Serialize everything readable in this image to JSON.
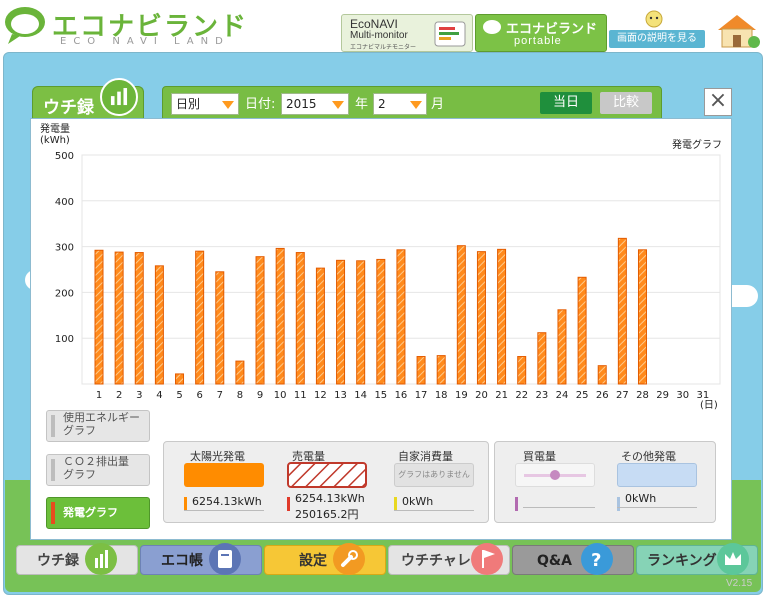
{
  "header": {
    "logo_text": "エコナビランド",
    "logo_sub": "ECO NAVI LAND",
    "econavi": {
      "line1": "EcoNAVI",
      "line2": "Multi-monitor",
      "line3": "エコナビマルチモニター"
    },
    "portable": {
      "line1": "エコナビランド",
      "line2": "portable"
    },
    "help_label": "画面の説明を見る"
  },
  "tab": {
    "label": "ウチ録"
  },
  "controls": {
    "period_value": "日別",
    "date_label": "日付:",
    "year_value": "2015",
    "year_suffix": "年",
    "month_value": "2",
    "month_suffix": "月",
    "today_label": "当日",
    "compare_label": "比較",
    "close_label": "×"
  },
  "chart_data": {
    "type": "bar",
    "title": "発電グラフ",
    "ylabel": "発電量\n(kWh)",
    "xlabel": "(日)",
    "ylim": [
      0,
      500
    ],
    "yticks": [
      100,
      200,
      300,
      400,
      500
    ],
    "grid": true,
    "categories": [
      "1",
      "2",
      "3",
      "4",
      "5",
      "6",
      "7",
      "8",
      "9",
      "10",
      "11",
      "12",
      "13",
      "14",
      "15",
      "16",
      "17",
      "18",
      "19",
      "20",
      "21",
      "22",
      "23",
      "24",
      "25",
      "26",
      "27",
      "28",
      "29",
      "30",
      "31"
    ],
    "series": [
      {
        "name": "発電量",
        "values": [
          292,
          288,
          287,
          258,
          22,
          290,
          245,
          50,
          278,
          296,
          287,
          253,
          270,
          269,
          272,
          293,
          60,
          62,
          302,
          289,
          294,
          60,
          112,
          162,
          233,
          40,
          318,
          293,
          null,
          null,
          null
        ]
      }
    ],
    "color": "#ff8a1c"
  },
  "side": {
    "energy": "使用エネルギー\nグラフ",
    "co2": "ＣＯ２排出量\nグラフ",
    "power": "発電グラフ"
  },
  "legend": {
    "solar": {
      "title": "太陽光発電",
      "value": "6254.13kWh",
      "color": "#ff8c00"
    },
    "sold": {
      "title": "売電量",
      "value": "6254.13kWh",
      "value2": "250165.2円"
    },
    "self": {
      "title": "自家消費量",
      "swatch_text": "グラフはありません",
      "value": "0kWh"
    },
    "bought": {
      "title": "買電量"
    },
    "other": {
      "title": "その他発電",
      "value": "0kWh"
    }
  },
  "nav": {
    "uchiroku": "ウチ録",
    "ecocho": "エコ帳",
    "settings": "設定",
    "uchichare": "ウチチャレ",
    "qa": "Q&A",
    "ranking": "ランキング"
  },
  "version": "V2.15"
}
